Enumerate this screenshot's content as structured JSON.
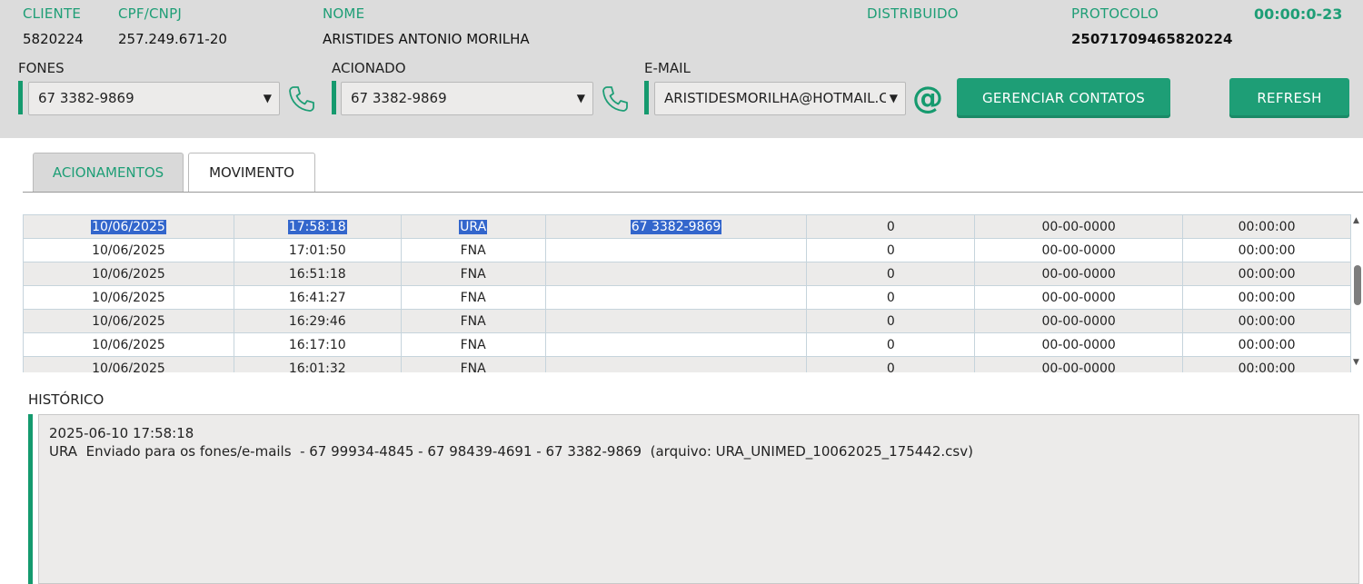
{
  "header": {
    "cliente_label": "CLIENTE",
    "cliente_value": "5820224",
    "cpf_label": "CPF/CNPJ",
    "cpf_value": "257.249.671-20",
    "nome_label": "NOME",
    "nome_value": "ARISTIDES ANTONIO MORILHA",
    "distribuido_label": "DISTRIBUIDO",
    "protocolo_label": "PROTOCOLO",
    "protocolo_value": "25071709465820224",
    "timer": "00:00:0-23"
  },
  "contacts": {
    "fones_label": "FONES",
    "fones_value": "67 3382-9869",
    "acionado_label": "ACIONADO",
    "acionado_value": "67 3382-9869",
    "email_label": "E-MAIL",
    "email_value": "ARISTIDESMORILHA@HOTMAIL.C",
    "at_symbol": "@",
    "gerenciar_button": "GERENCIAR CONTATOS",
    "refresh_button": "REFRESH"
  },
  "tabs": {
    "acionamentos": "ACIONAMENTOS",
    "movimento": "MOVIMENTO"
  },
  "table": {
    "rows": [
      {
        "date": "10/06/2025",
        "time": "17:58:18",
        "type": "URA",
        "phone": "67 3382-9869",
        "count": "0",
        "date2": "00-00-0000",
        "time2": "00:00:00"
      },
      {
        "date": "10/06/2025",
        "time": "17:01:50",
        "type": "FNA",
        "phone": "",
        "count": "0",
        "date2": "00-00-0000",
        "time2": "00:00:00"
      },
      {
        "date": "10/06/2025",
        "time": "16:51:18",
        "type": "FNA",
        "phone": "",
        "count": "0",
        "date2": "00-00-0000",
        "time2": "00:00:00"
      },
      {
        "date": "10/06/2025",
        "time": "16:41:27",
        "type": "FNA",
        "phone": "",
        "count": "0",
        "date2": "00-00-0000",
        "time2": "00:00:00"
      },
      {
        "date": "10/06/2025",
        "time": "16:29:46",
        "type": "FNA",
        "phone": "",
        "count": "0",
        "date2": "00-00-0000",
        "time2": "00:00:00"
      },
      {
        "date": "10/06/2025",
        "time": "16:17:10",
        "type": "FNA",
        "phone": "",
        "count": "0",
        "date2": "00-00-0000",
        "time2": "00:00:00"
      },
      {
        "date": "10/06/2025",
        "time": "16:01:32",
        "type": "FNA",
        "phone": "",
        "count": "0",
        "date2": "00-00-0000",
        "time2": "00:00:00"
      }
    ]
  },
  "historico": {
    "label": "HISTÓRICO",
    "line1": "2025-06-10 17:58:18",
    "line2": "URA  Enviado para os fones/e-mails  - 67 99934-4845 - 67 98439-4691 - 67 3382-9869  (arquivo: URA_UNIMED_10062025_175442.csv)"
  },
  "icons": {
    "phone": "phone-icon",
    "email": "at-icon",
    "dropdown": "chevron-down-icon"
  },
  "colors": {
    "accent": "#1e9e76",
    "selection": "#3366cc",
    "header_bg": "#dcdcdc"
  }
}
